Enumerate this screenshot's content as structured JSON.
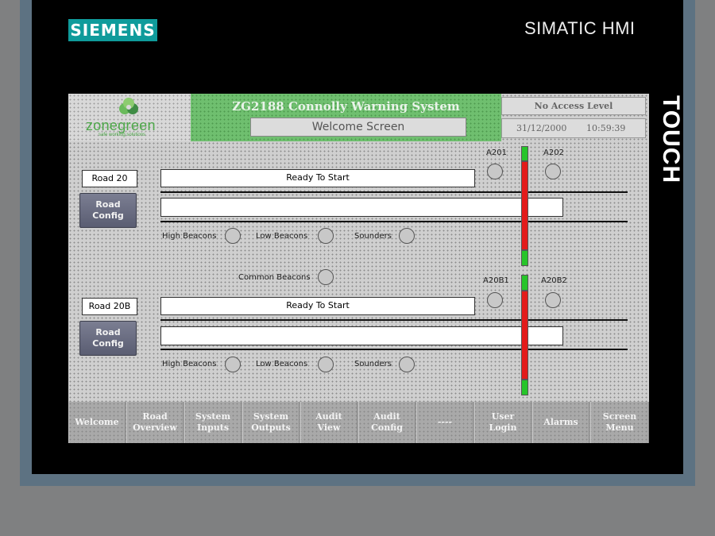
{
  "device": {
    "brand": "SIEMENS",
    "model": "SIMATIC HMI",
    "side_label": "TOUCH"
  },
  "header": {
    "logo_text": "zonegreen",
    "logo_tagline": "safe working solutions",
    "title": "ZG2188 Connolly Warning System",
    "screen_name": "Welcome Screen",
    "access_level": "No Access Level",
    "date": "31/12/2000",
    "time": "10:59:39"
  },
  "roads": [
    {
      "name": "Road 20",
      "status": "Ready To Start",
      "config_label": "Road\nConfig",
      "detector_left": "A201",
      "detector_right": "A202",
      "high_beacons": "High Beacons",
      "low_beacons": "Low Beacons",
      "sounders": "Sounders"
    },
    {
      "name": "Road 20B",
      "status": "Ready To Start",
      "config_label": "Road\nConfig",
      "detector_left": "A20B1",
      "detector_right": "A20B2",
      "high_beacons": "High Beacons",
      "low_beacons": "Low Beacons",
      "sounders": "Sounders"
    }
  ],
  "common_beacons": "Common Beacons",
  "colors": {
    "track_red": "#e31b1b",
    "track_green": "#27c52a",
    "title_band": "#6fbf6f",
    "siemens_teal": "#0f9b9b"
  },
  "nav": [
    "Welcome",
    "Road\nOverview",
    "System\nInputs",
    "System\nOutputs",
    "Audit\nView",
    "Audit\nConfig",
    "----",
    "User\nLogin",
    "Alarms",
    "Screen\nMenu"
  ]
}
